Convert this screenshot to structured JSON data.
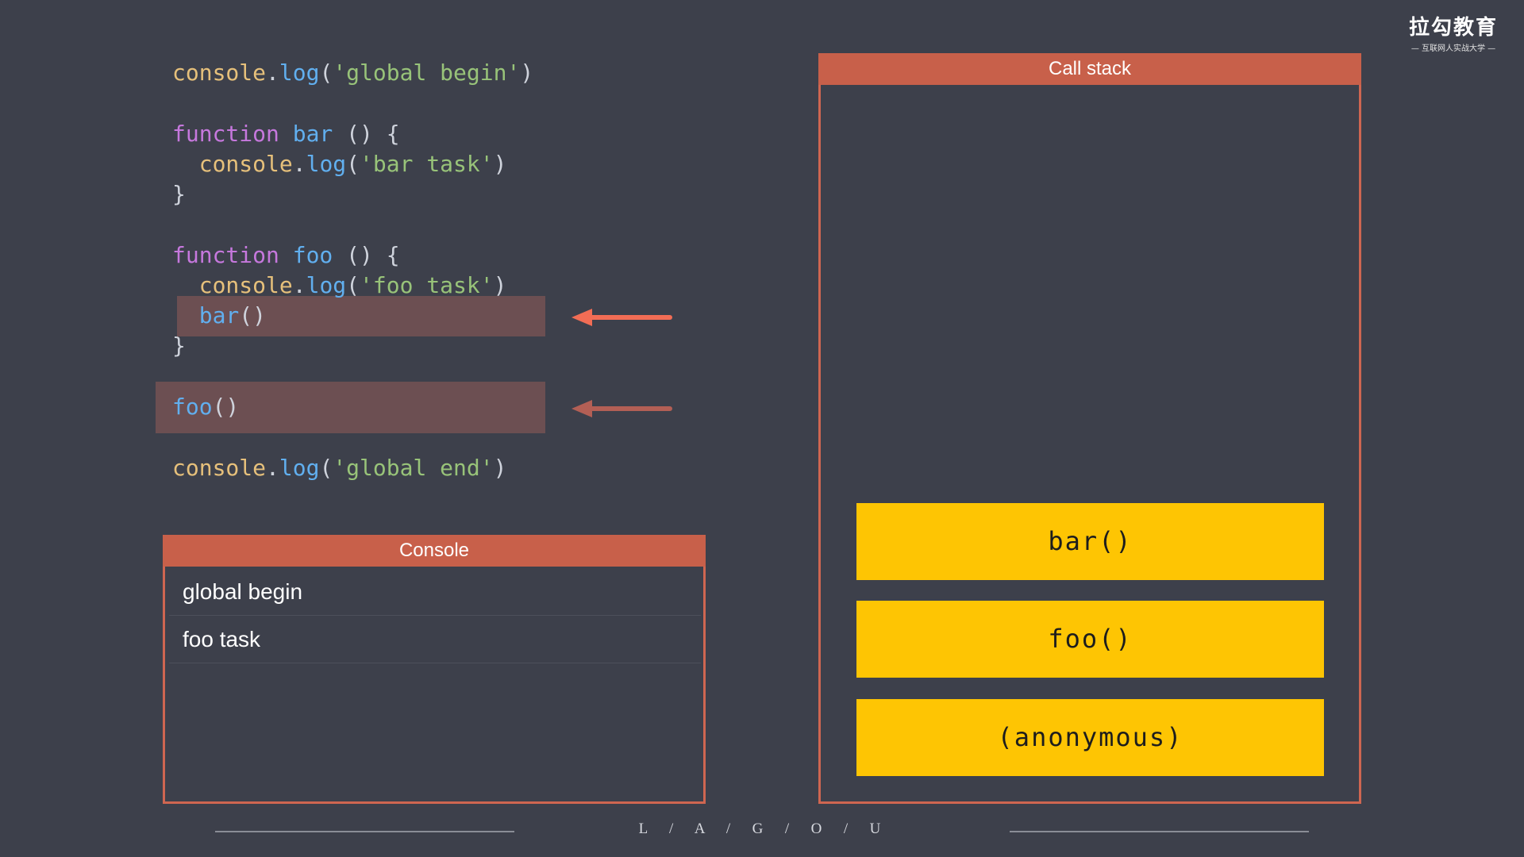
{
  "code": {
    "line1": {
      "obj": "console",
      "dot": ".",
      "fn": "log",
      "open": "(",
      "str": "'global begin'",
      "close": ")"
    },
    "line3": {
      "kw": "function",
      "name": "bar",
      "rest": " () {"
    },
    "line4": {
      "indent": "  ",
      "obj": "console",
      "dot": ".",
      "fn": "log",
      "open": "(",
      "str": "'bar task'",
      "close": ")"
    },
    "line5": "}",
    "line7": {
      "kw": "function",
      "name": "foo",
      "rest": " () {"
    },
    "line8": {
      "indent": "  ",
      "obj": "console",
      "dot": ".",
      "fn": "log",
      "open": "(",
      "str": "'foo task'",
      "close": ")"
    },
    "line9": {
      "indent": "  ",
      "fn": "bar",
      "paren": "()"
    },
    "line10": "}",
    "line12": {
      "fn": "foo",
      "paren": "()"
    },
    "line14": {
      "obj": "console",
      "dot": ".",
      "fn": "log",
      "open": "(",
      "str": "'global end'",
      "close": ")"
    }
  },
  "console_panel": {
    "title": "Console",
    "entries": [
      "global begin",
      "foo task"
    ]
  },
  "call_stack": {
    "title": "Call stack",
    "frames": [
      "bar()",
      "foo()",
      "(anonymous)"
    ]
  },
  "footer": {
    "text": "L  /  A  /  G  /  O  /  U"
  },
  "logo": {
    "main": "拉勾教育",
    "sub": "— 互联网人实战大学 —"
  },
  "colors": {
    "background": "#3d404b",
    "panel_header": "#c8604a",
    "panel_border": "#cf6651",
    "stack_frame": "#fec503",
    "highlight": "#6c4f52",
    "active_arrow": "#f26d55",
    "inactive_arrow": "#b35f55"
  }
}
